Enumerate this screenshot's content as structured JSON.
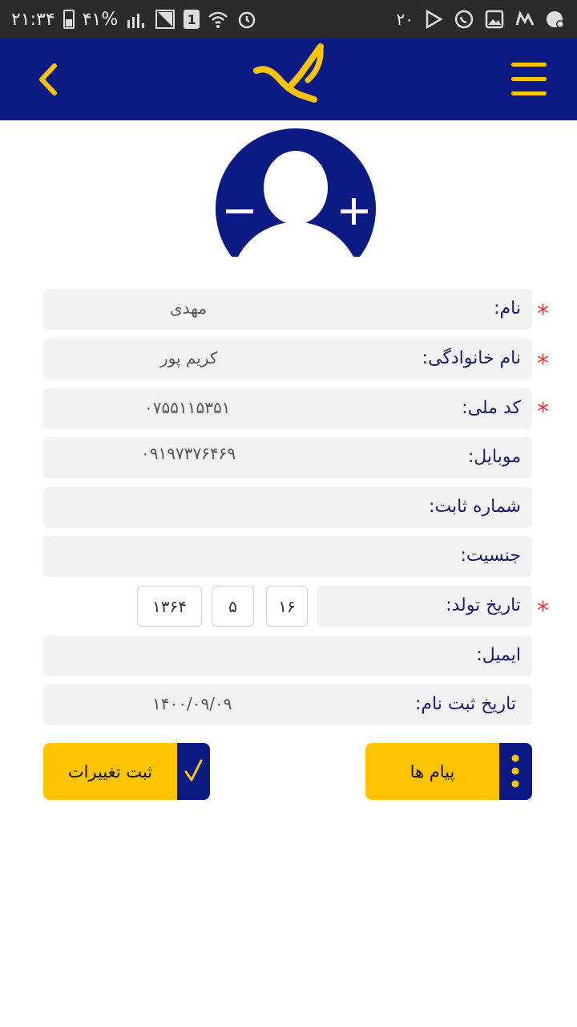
{
  "status_bar": {
    "time": "۲۱:۳۴",
    "battery": "۴۱%",
    "sim_slot": "1",
    "notification_count": "۲۰"
  },
  "app_bar": {
    "menu_icon": "hamburger-menu-icon",
    "back_icon": "chevron-left-icon",
    "logo": "post-logo"
  },
  "avatar": {
    "remove_icon": "minus-icon",
    "add_icon": "plus-icon"
  },
  "form": {
    "first_name": {
      "label": "نام:",
      "value": "مهدی",
      "required": true
    },
    "last_name": {
      "label": "نام خانوادگی:",
      "value": "کریم پور",
      "required": true
    },
    "national_code": {
      "label": "کد ملی:",
      "value": "۰۷۵۵۱۱۵۳۵۱",
      "required": true
    },
    "mobile": {
      "label": "موبایل:",
      "value": "۰۹۱۹۷۳۷۶۴۶۹",
      "required": false
    },
    "phone": {
      "label": "شماره ثابت:",
      "value": "",
      "required": false
    },
    "gender": {
      "label": "جنسیت:",
      "value": "",
      "required": false
    },
    "birth_date": {
      "label": "تاریخ تولد:",
      "day": "۱۶",
      "month": "۵",
      "year": "۱۳۶۴",
      "required": true
    },
    "email": {
      "label": "ایمیل:",
      "value": "",
      "required": false
    },
    "register_date": {
      "label": "تاریخ ثبت نام:",
      "value": "۱۴۰۰/۰۹/۰۹"
    }
  },
  "required_mark": "*",
  "buttons": {
    "save_label": "ثبت تغییرات",
    "messages_label": "پیام ها"
  },
  "colors": {
    "primary": "#0a1a82",
    "accent": "#ffc400",
    "required": "#e53935"
  }
}
